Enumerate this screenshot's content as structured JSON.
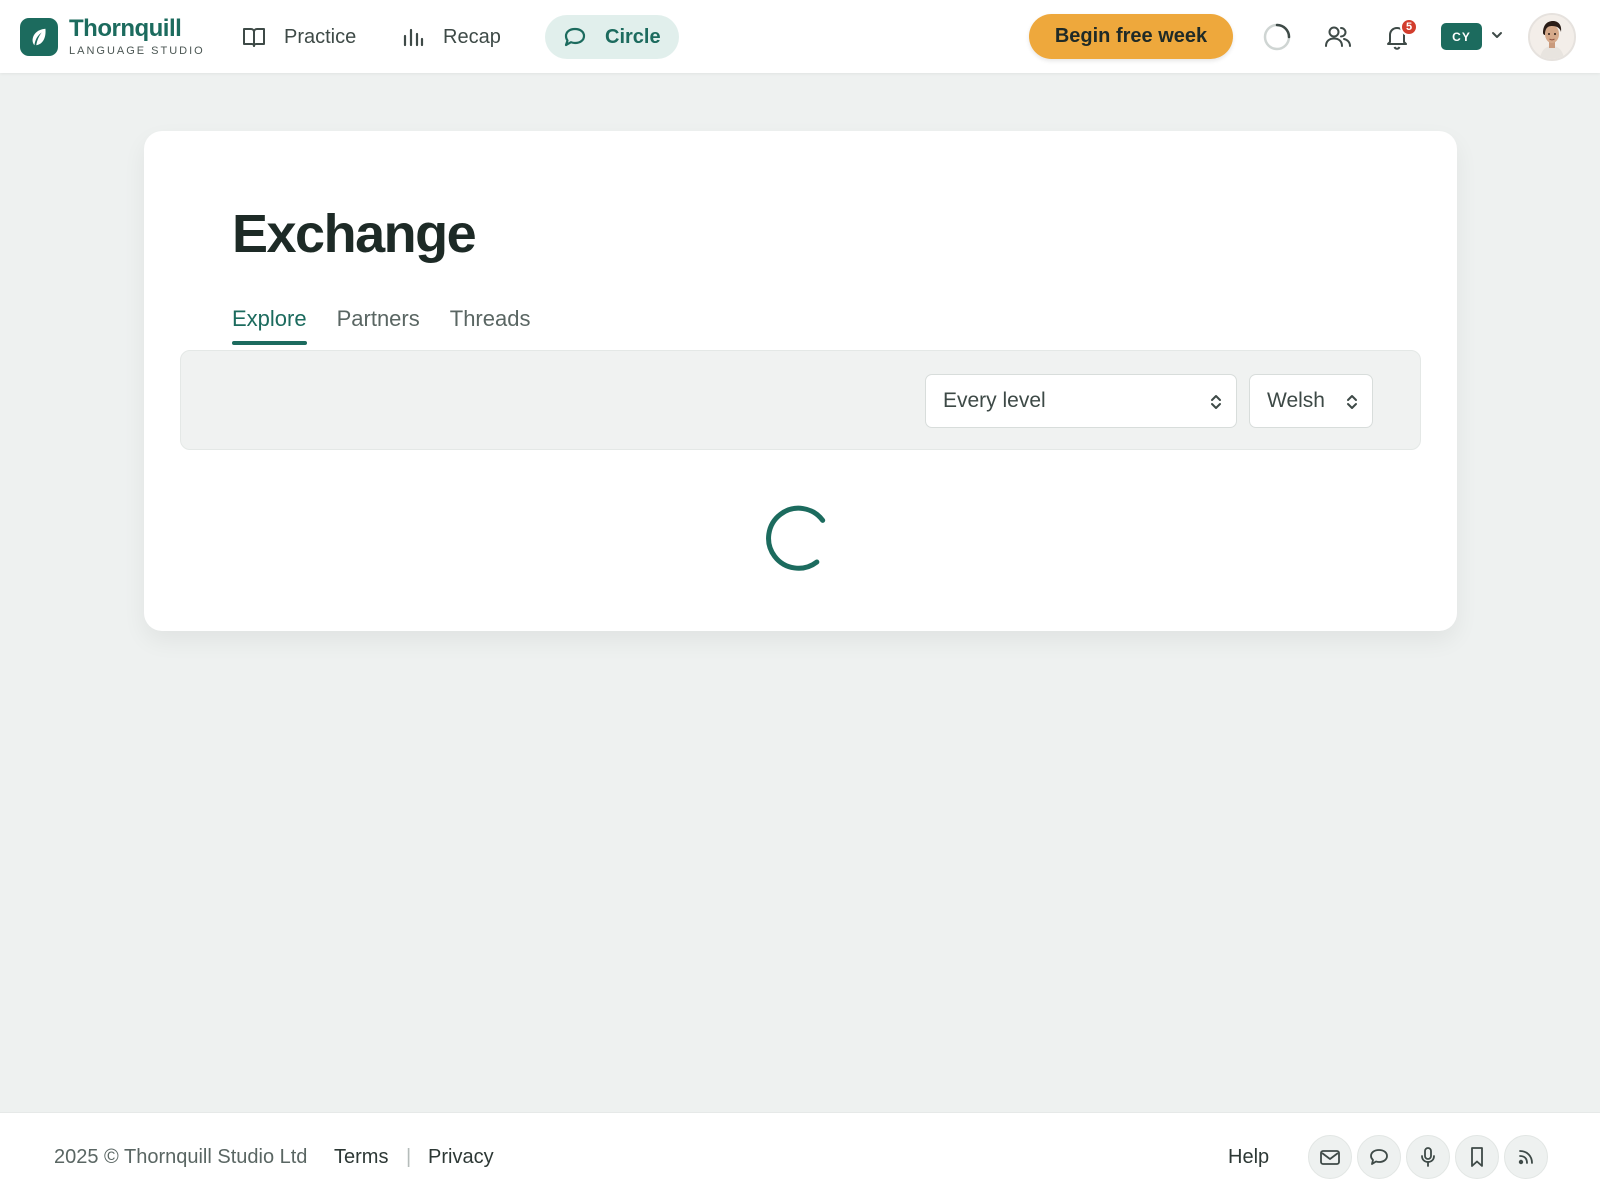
{
  "brand": {
    "name": "Thornquill",
    "tagline": "LANGUAGE STUDIO",
    "color": "#1c6b5e"
  },
  "nav": {
    "items": [
      {
        "label": "Practice",
        "icon": "book-icon"
      },
      {
        "label": "Recap",
        "icon": "bar-chart-icon"
      },
      {
        "label": "Circle",
        "icon": "chat-bubble-icon",
        "active": true
      }
    ]
  },
  "header": {
    "cta_label": "Begin free week",
    "cta_color": "#eea83c",
    "notification_count": "5",
    "language_code": "CY",
    "icons": [
      "loading-spinner-icon",
      "people-icon",
      "bell-icon",
      "chevron-down-icon",
      "avatar"
    ]
  },
  "main": {
    "title": "Exchange",
    "tabs": [
      {
        "label": "Explore",
        "active": true
      },
      {
        "label": "Partners"
      },
      {
        "label": "Threads"
      }
    ],
    "filters": {
      "level": {
        "value": "Every level"
      },
      "language": {
        "value": "Welsh"
      }
    },
    "loading": true
  },
  "footer": {
    "copyright": "2025 © Thornquill Studio Ltd",
    "links": {
      "terms": "Terms",
      "separator": "|",
      "privacy": "Privacy",
      "help": "Help"
    },
    "social_icons": [
      "mail-icon",
      "chat-icon",
      "microphone-icon",
      "bookmark-icon",
      "rss-icon"
    ]
  }
}
